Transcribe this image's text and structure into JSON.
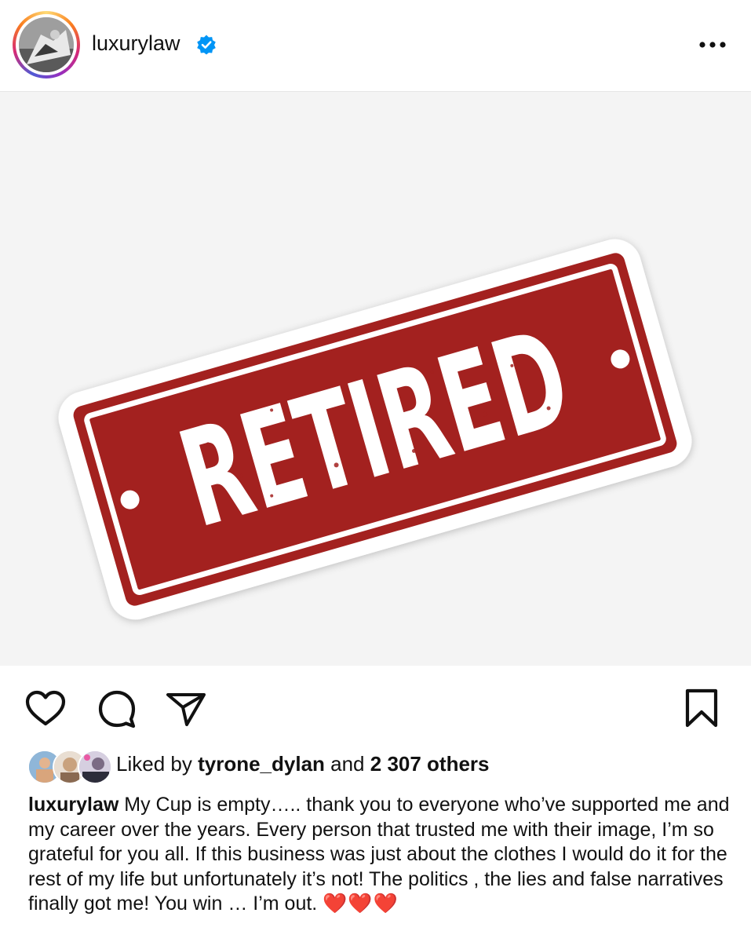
{
  "post": {
    "username": "luxurylaw",
    "verified": true,
    "more_icon": "more-horizontal-icon",
    "image": {
      "sign_text": "RETIRED",
      "colors": {
        "sign_red": "#a3211f",
        "sign_white": "#ffffff",
        "background": "#f4f4f4"
      }
    },
    "actions": {
      "like_icon": "heart-outline-icon",
      "comment_icon": "comment-bubble-icon",
      "share_icon": "paper-plane-icon",
      "save_icon": "bookmark-outline-icon"
    },
    "likes": {
      "prefix": "Liked by",
      "user": "tyrone_dylan",
      "connector": "and",
      "count_text": "2 307 others"
    },
    "caption": {
      "username": "luxurylaw",
      "text": "My Cup is empty….. thank you to everyone who’ve supported me and my career over the years. Every person that trusted me with their image, I’m so grateful for you all. If this business was just about the clothes I would do it for the rest of my life but unfortunately it’s not! The politics , the lies and false narratives  finally got me! You win … I’m out.",
      "emoji": "❤️❤️❤️"
    }
  }
}
